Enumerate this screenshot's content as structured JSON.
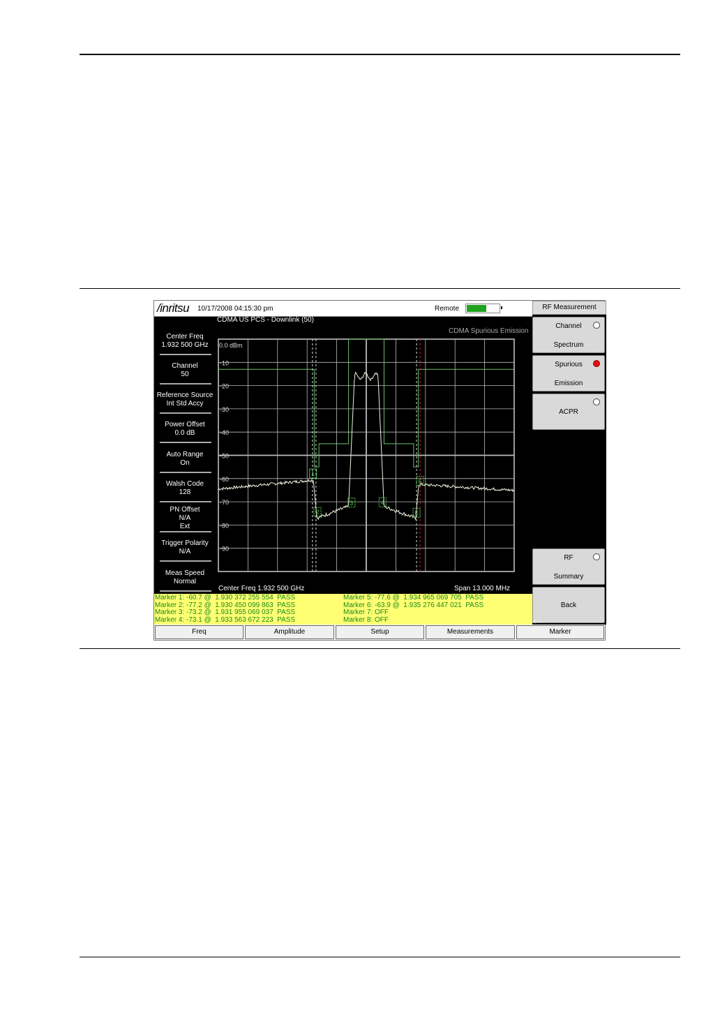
{
  "app": {
    "brand": "/inritsu",
    "datetime": "10/17/2008 04:15:30 pm",
    "remote_label": "Remote",
    "subtitle": "CDMA US PCS - Downlink (50)",
    "measurement_title": "CDMA Spurious Emission",
    "ref_level": "0.0 dBm",
    "center_freq_label": "Center Freq 1.932 500 GHz",
    "span_label": "Span 13.000 MHz"
  },
  "left_panel": [
    {
      "line1": "Center Freq",
      "line2": "1.932 500 GHz"
    },
    {
      "line1": "Channel",
      "line2": "50"
    },
    {
      "line1": "Reference Source",
      "line2": "Int Std Accy"
    },
    {
      "line1": "Power Offset",
      "line2": "0.0 dB"
    },
    {
      "line1": "Auto Range",
      "line2": "On"
    },
    {
      "line1": "Walsh Code",
      "line2": "128"
    },
    {
      "line1": "PN Offset",
      "line2": "N/A",
      "line3": "Ext"
    },
    {
      "line1": "Trigger Polarity",
      "line2": "N/A"
    },
    {
      "line1": "Meas Speed",
      "line2": "Normal"
    }
  ],
  "markers_left": [
    "Marker 1: -60.7 @  1.930 372 255 554  PASS",
    "Marker 2: -77.2 @  1.930 450 099 863  PASS",
    "Marker 3: -73.2 @  1.931 955 069 037  PASS",
    "Marker 4: -73.1 @  1.933 563 672 223  PASS"
  ],
  "markers_right": [
    "Marker 5: -77.6 @  1.934 965 069 705  PASS",
    "Marker 6: -63.9 @  1.935 276 447 021  PASS",
    "Marker 7: OFF",
    "Marker 8: OFF"
  ],
  "right_panel": {
    "title": "RF Measurement",
    "buttons": [
      {
        "line1": "Channel",
        "line2": "Spectrum",
        "radio": "off"
      },
      {
        "line1": "Spurious",
        "line2": "Emission",
        "radio": "on"
      },
      {
        "line1": "ACPR",
        "line2": "",
        "radio": "off"
      },
      {
        "line1": "RF",
        "line2": "Summary",
        "radio": "off"
      },
      {
        "line1": "Back",
        "line2": ""
      }
    ],
    "back_arrows": "<---"
  },
  "bottom_menu": [
    "Freq",
    "Amplitude",
    "Setup",
    "Measurements",
    "Marker"
  ],
  "chart_data": {
    "type": "line",
    "ylim": [
      -100,
      0
    ],
    "y_ticks": [
      "-10",
      "-20",
      "-30",
      "-40",
      "-50",
      "-60",
      "-70",
      "-80",
      "-90"
    ],
    "x_divisions": 10,
    "marker_labels": [
      "1",
      "2",
      "3",
      "4",
      "5",
      "6"
    ],
    "colors": {
      "trace": "#f2f2e0",
      "grid": "#bbbbbb",
      "limit": "#6fbf6f",
      "marker": "#52c452",
      "red_line": "#d02020"
    }
  }
}
